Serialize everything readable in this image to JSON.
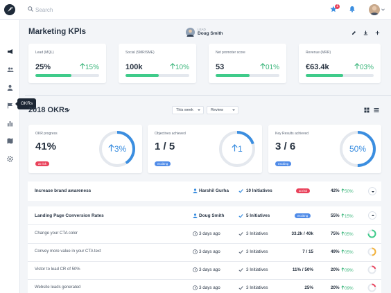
{
  "colors": {
    "accent": "#3b8ee0",
    "green": "#39b57a",
    "red": "#e9415a",
    "blue_badge": "#4f8be8",
    "dark": "#1c2633"
  },
  "topbar": {
    "search_placeholder": "Search",
    "notification_count": "1"
  },
  "sidebar": {
    "items": [
      "megaphone-icon",
      "team-icon",
      "user-icon",
      "flag-icon",
      "chart-icon",
      "map-icon",
      "settings-icon"
    ],
    "tooltip": "OKRs"
  },
  "header": {
    "title": "Marketing KPIs",
    "lead_label": "LEAD",
    "lead_name": "Doug Smith"
  },
  "kpis": [
    {
      "label": "Lead (MQL)",
      "value": "25%",
      "change": "15%",
      "progress": 0.56
    },
    {
      "label": "Social (SMR/SME)",
      "value": "100k",
      "change": "10%",
      "progress": 0.52
    },
    {
      "label": "Net promoter score",
      "value": "53",
      "change": "01%",
      "progress": 0.53
    },
    {
      "label": "Revenue (MRR)",
      "value": "€63.4k",
      "change": "03%",
      "progress": 0.55
    }
  ],
  "okr_section": {
    "title": "2018 OKRs",
    "filter_period": "This week",
    "filter_mode": "Review"
  },
  "okr_cards": [
    {
      "label": "OKR progress",
      "value": "41%",
      "badge": "at risk",
      "ring_text": "3%",
      "ring_fraction": 0.41
    },
    {
      "label": "Objectives achieved",
      "value": "1 / 5",
      "badge": "exciting",
      "ring_text": "1",
      "ring_fraction": 0.2
    },
    {
      "label": "Key Results achieved",
      "value": "3 / 6",
      "badge": "exciting",
      "ring_text": "50%",
      "ring_fraction": 0.5
    }
  ],
  "objectives": [
    {
      "title": "Increase brand awareness",
      "owner": "Harshil Gurha",
      "initiatives": "10 Initiatives",
      "badge": "at risk",
      "progress": "42%",
      "change": "50%"
    },
    {
      "title": "Landing Page Conversion Rates",
      "owner": "Doug Smith",
      "initiatives": "5 Initiatives",
      "badge": "exciting",
      "progress": "55%",
      "change": "15%"
    }
  ],
  "key_results": [
    {
      "title": "Change your CTA color",
      "due": "3 days ago",
      "initiatives": "3 Initiatives",
      "ratio": "33.2k / 40k",
      "progress": "75%",
      "change": "05%",
      "fraction": 0.75,
      "color": "#3fcb8a"
    },
    {
      "title": "Convey more value in your CTA text",
      "due": "3 days ago",
      "initiatives": "3 Initiatives",
      "ratio": "7 / 15",
      "progress": "49%",
      "change": "05%",
      "fraction": 0.49,
      "color": "#f3b23a"
    },
    {
      "title": "Vistor to lead CR of 50%",
      "due": "3 days ago",
      "initiatives": "3 Initiatives",
      "ratio": "11% / 50%",
      "progress": "20%",
      "change": "09%",
      "fraction": 0.2,
      "color": "#e9415a"
    },
    {
      "title": "Website leads generated",
      "due": "3 days ago",
      "initiatives": "3 Initiatives",
      "ratio": "25%",
      "progress": "20%",
      "change": "09%",
      "fraction": 0.2,
      "color": "#e9415a"
    }
  ]
}
